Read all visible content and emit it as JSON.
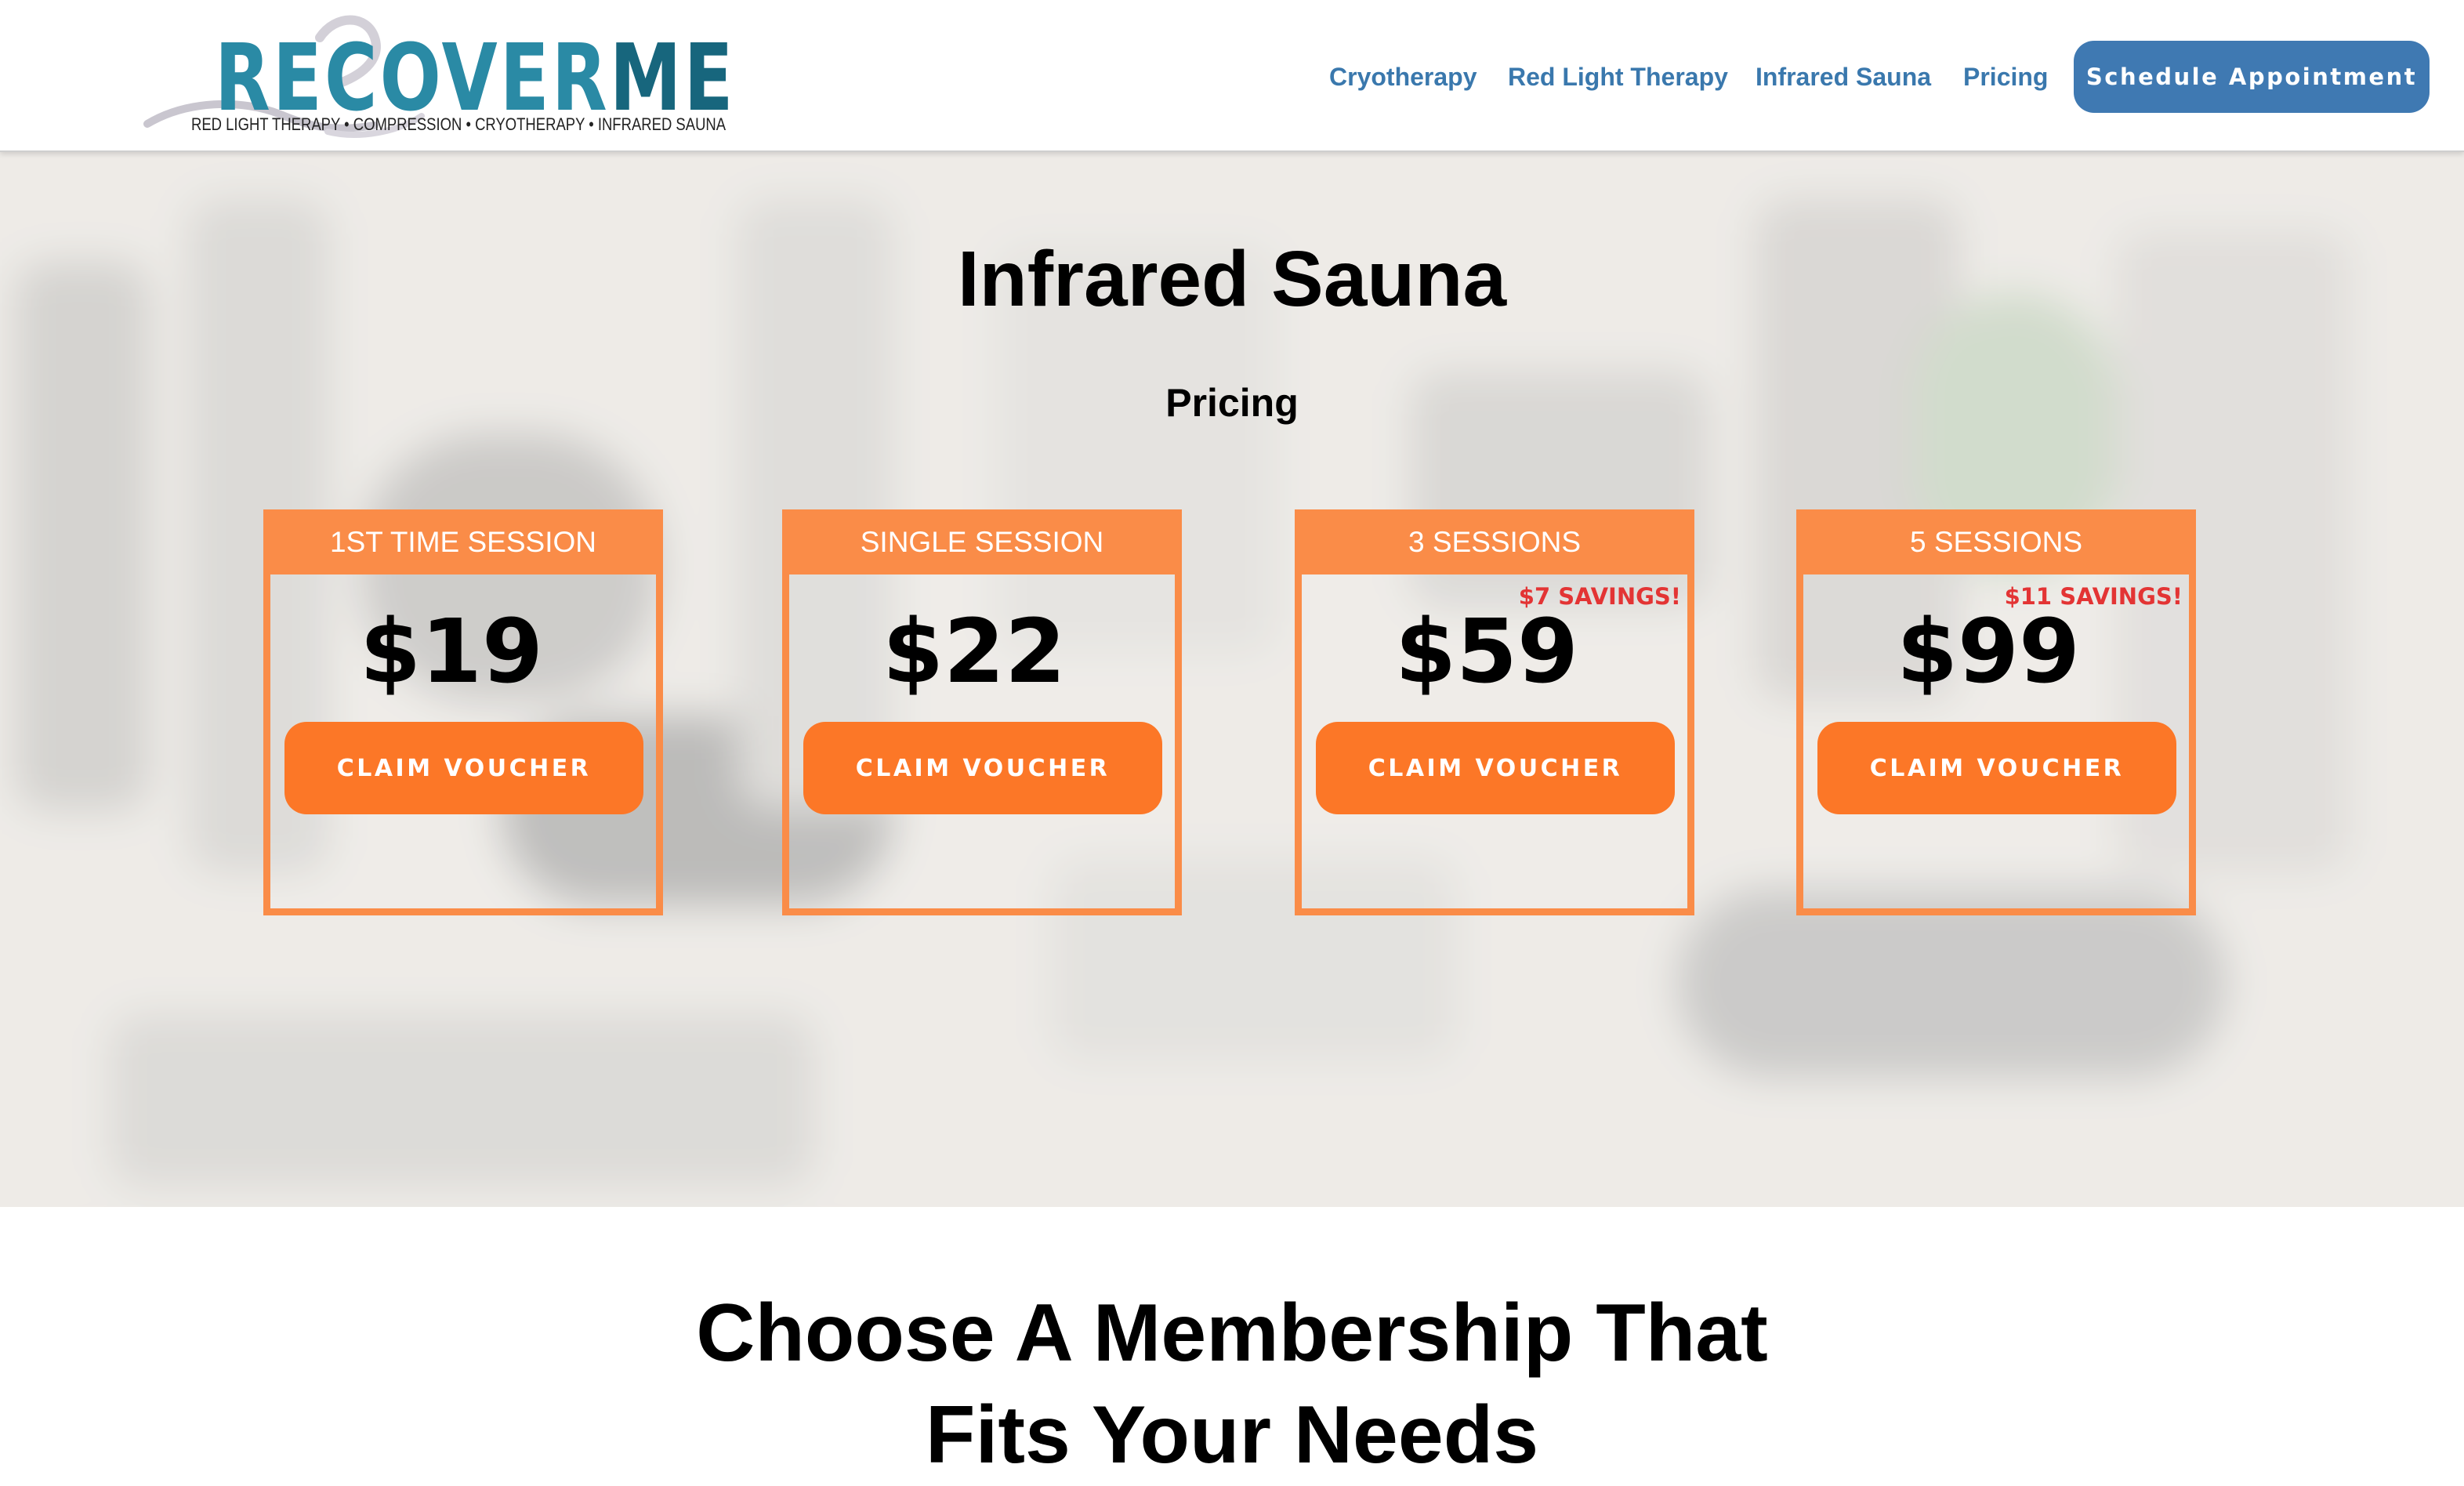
{
  "brand": {
    "name_part1": "RECOVER",
    "name_part2": "ME",
    "tagline": "RED LIGHT THERAPY • COMPRESSION • CRYOTHERAPY • INFRARED SAUNA"
  },
  "nav": {
    "links": [
      "Cryotherapy",
      "Red Light Therapy",
      "Infrared Sauna",
      "Pricing"
    ],
    "cta_label": "Schedule Appointment"
  },
  "hero": {
    "title": "Infrared Sauna",
    "subtitle": "Pricing"
  },
  "pricing": [
    {
      "label": "1ST TIME SESSION",
      "price": "$19",
      "savings": "",
      "button": "CLAIM VOUCHER"
    },
    {
      "label": "SINGLE SESSION",
      "price": "$22",
      "savings": "",
      "button": "CLAIM VOUCHER"
    },
    {
      "label": "3 SESSIONS",
      "price": "$59",
      "savings": "$7 SAVINGS!",
      "button": "CLAIM VOUCHER"
    },
    {
      "label": "5 SESSIONS",
      "price": "$99",
      "savings": "$11 SAVINGS!",
      "button": "CLAIM VOUCHER"
    }
  ],
  "membership": {
    "title_line1": "Choose A Membership That",
    "title_line2": "Fits Your Needs"
  },
  "colors": {
    "accent_orange": "#fa8c48",
    "button_orange": "#fc7727",
    "nav_blue": "#3a78ad",
    "cta_blue": "#3f79b2",
    "savings_red": "#e33434",
    "logo_teal": "#2a8aa5"
  }
}
